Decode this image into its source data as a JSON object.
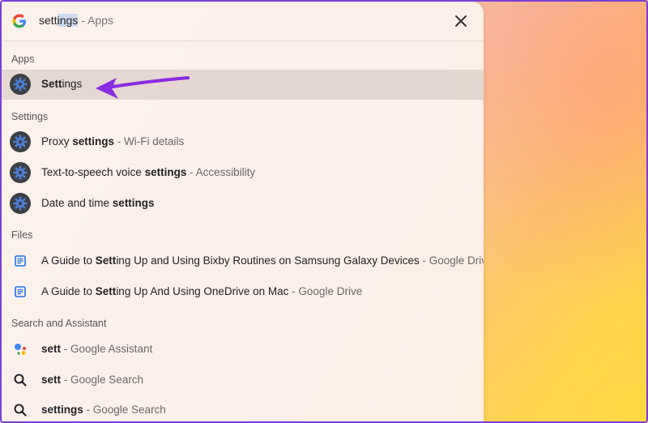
{
  "search": {
    "query_pre": "sett",
    "query_sel": "ings",
    "suffix": "- Apps"
  },
  "sections": {
    "apps": "Apps",
    "settings": "Settings",
    "files": "Files",
    "search_assistant": "Search and Assistant"
  },
  "rows": {
    "settings_app": {
      "bold": "Sett",
      "rest": "ings",
      "sub": ""
    },
    "proxy": {
      "pre": "Proxy ",
      "bold": "settings",
      "sub": " - Wi-Fi details"
    },
    "tts": {
      "pre": "Text-to-speech voice ",
      "bold": "settings",
      "sub": " - Accessibility"
    },
    "datetime": {
      "pre": "Date and time ",
      "bold": "settings",
      "sub": ""
    },
    "file1": {
      "pre": "A Guide to ",
      "bold": "Sett",
      "rest": "ing Up and Using Bixby Routines on Samsung Galaxy Devices",
      "sub": " - Google Drive"
    },
    "file2": {
      "pre": "A Guide to ",
      "bold": "Sett",
      "rest": "ing Up And Using OneDrive on Mac",
      "sub": " - Google Drive"
    },
    "assistant": {
      "bold": "sett",
      "sub": " - Google Assistant"
    },
    "search1": {
      "bold": "sett",
      "sub": " - Google Search"
    },
    "search2": {
      "bold": "settings",
      "sub": " - Google Search"
    }
  },
  "colors": {
    "arrow": "#8a2be2",
    "accent": "#7a3fd2",
    "gear_outer": "#3c4043",
    "gear_inner": "#4a7fd8"
  }
}
